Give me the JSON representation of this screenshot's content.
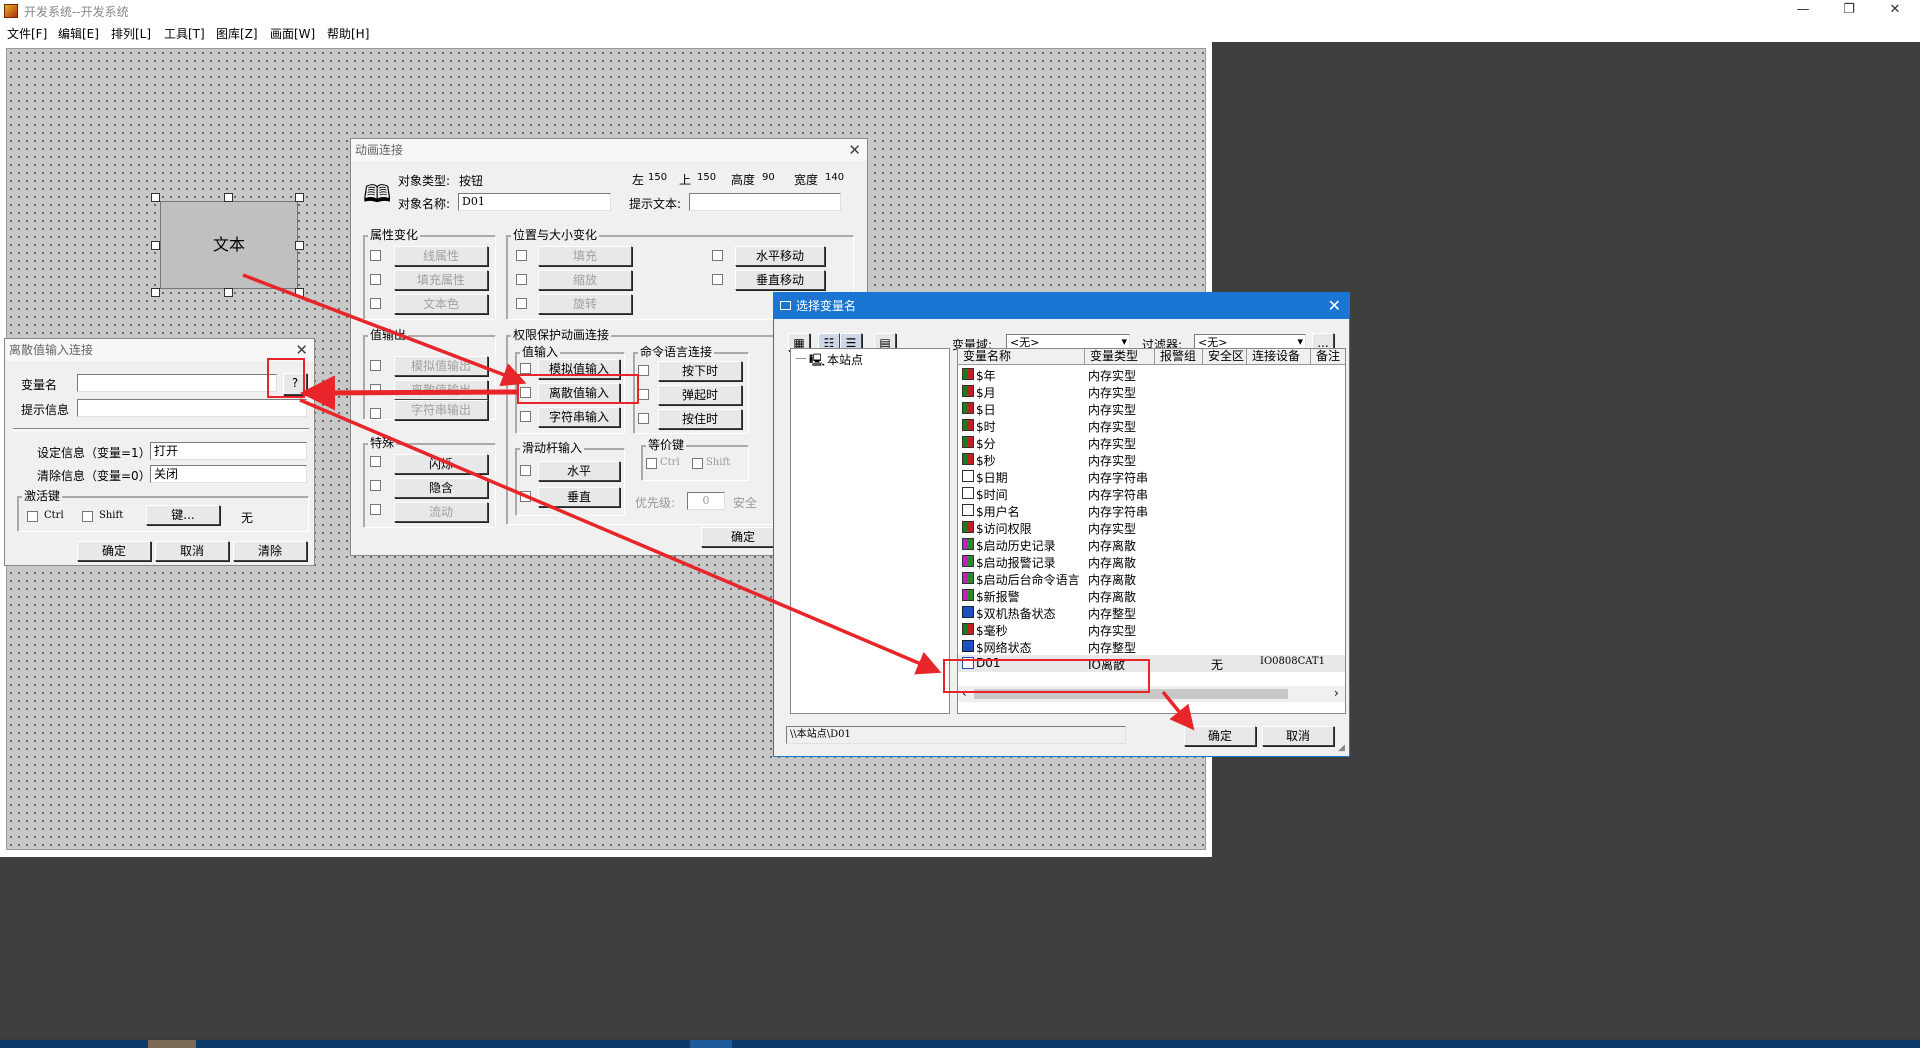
{
  "window": {
    "title": "开发系统--开发系统",
    "minimize": "—",
    "restore": "❐",
    "close": "✕"
  },
  "menu": [
    "文件[F]",
    "编辑[E]",
    "排列[L]",
    "工具[T]",
    "图库[Z]",
    "画面[W]",
    "帮助[H]"
  ],
  "canvas": {
    "widget_text": "文本"
  },
  "anim_dialog": {
    "title": "动画连接",
    "object_type_label": "对象类型:",
    "object_type": "按钮",
    "left_label": "左",
    "left": "150",
    "top_label": "上",
    "top": "150",
    "height_label": "高度",
    "height": "90",
    "width_label": "宽度",
    "width": "140",
    "object_name_label": "对象名称:",
    "object_name": "D01",
    "hint_label": "提示文本:",
    "hint_value": "",
    "grp_attr": "属性变化",
    "attr_buttons": [
      "线属性",
      "填充属性",
      "文本色"
    ],
    "grp_pos": "位置与大小变化",
    "pos_buttons": [
      "填充",
      "缩放",
      "旋转"
    ],
    "move_buttons": [
      "水平移动",
      "垂直移动"
    ],
    "grp_valout": "值输出",
    "valout_buttons": [
      "模拟值输出",
      "离散值输出",
      "字符串输出"
    ],
    "grp_perm": "权限保护动画连接",
    "grp_valin": "值输入",
    "valin_buttons": [
      "模拟值输入",
      "离散值输入",
      "字符串输入"
    ],
    "grp_cmd": "命令语言连接",
    "cmd_buttons": [
      "按下时",
      "弹起时",
      "按住时"
    ],
    "grp_special": "特殊",
    "special_buttons": [
      "闪烁",
      "隐含",
      "流动"
    ],
    "grp_slider": "滑动杆输入",
    "slider_buttons": [
      "水平",
      "垂直"
    ],
    "grp_equiv": "等价键",
    "ctrl": "Ctrl",
    "shift": "Shift",
    "priority_label": "优先级:",
    "priority": "0",
    "security_label": "安全",
    "ok": "确定"
  },
  "discrete_dialog": {
    "title": "离散值输入连接",
    "var_label": "变量名",
    "var_value": "",
    "browse": "?",
    "hint_label": "提示信息",
    "hint_value": "",
    "set_label": "设定信息（变量=1）",
    "set_value": "打开",
    "clear_label": "清除信息（变量=0）",
    "clear_value": "关闭",
    "grp_hotkey": "激活键",
    "ctrl": "Ctrl",
    "shift": "Shift",
    "key_button": "键...",
    "key_value": "无",
    "ok": "确定",
    "cancel": "取消",
    "clear": "清除"
  },
  "select_dialog": {
    "title": "选择变量名",
    "domain_label": "变量域:",
    "domain_value": "<无>",
    "filter_label": "过滤器:",
    "filter_value": "<无>",
    "more": "...",
    "tree_root": "本站点",
    "columns": [
      "变量名称",
      "变量类型",
      "报警组",
      "安全区",
      "连接设备",
      "备注"
    ],
    "rows": [
      {
        "name": "$年",
        "type": "内存实型",
        "icon": "ic-grid"
      },
      {
        "name": "$月",
        "type": "内存实型",
        "icon": "ic-grid"
      },
      {
        "name": "$日",
        "type": "内存实型",
        "icon": "ic-grid"
      },
      {
        "name": "$时",
        "type": "内存实型",
        "icon": "ic-grid"
      },
      {
        "name": "$分",
        "type": "内存实型",
        "icon": "ic-grid"
      },
      {
        "name": "$秒",
        "type": "内存实型",
        "icon": "ic-grid"
      },
      {
        "name": "$日期",
        "type": "内存字符串",
        "icon": "ic-str"
      },
      {
        "name": "$时间",
        "type": "内存字符串",
        "icon": "ic-str"
      },
      {
        "name": "$用户名",
        "type": "内存字符串",
        "icon": "ic-str"
      },
      {
        "name": "$访问权限",
        "type": "内存实型",
        "icon": "ic-grid"
      },
      {
        "name": "$启动历史记录",
        "type": "内存离散",
        "icon": "ic-disc"
      },
      {
        "name": "$启动报警记录",
        "type": "内存离散",
        "icon": "ic-disc"
      },
      {
        "name": "$启动后台命令语言",
        "type": "内存离散",
        "icon": "ic-disc"
      },
      {
        "name": "$新报警",
        "type": "内存离散",
        "icon": "ic-disc"
      },
      {
        "name": "$双机热备状态",
        "type": "内存整型",
        "icon": "ic-int"
      },
      {
        "name": "$毫秒",
        "type": "内存实型",
        "icon": "ic-grid"
      },
      {
        "name": "$网络状态",
        "type": "内存整型",
        "icon": "ic-int"
      },
      {
        "name": "D01",
        "type": "IO离散",
        "icon": "ic-io",
        "security": "无",
        "device": "IO0808CAT1"
      }
    ],
    "path": "\\\\本站点\\D01",
    "ok": "确定",
    "cancel": "取消"
  },
  "colors": {
    "highlight": "#e8262a",
    "title_blue": "#1a76d2"
  }
}
